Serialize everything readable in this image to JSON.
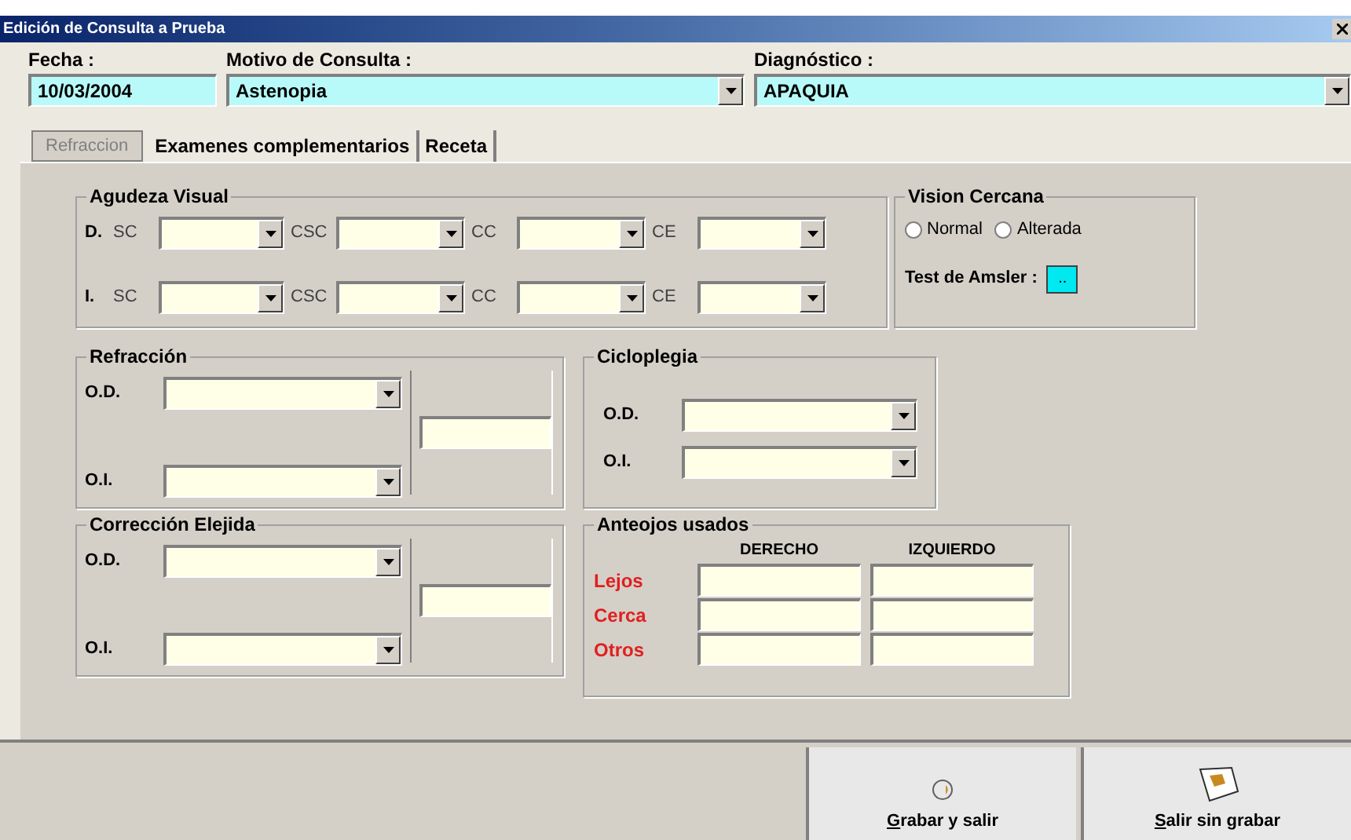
{
  "window": {
    "title": "Edición de Consulta a Prueba"
  },
  "header_fields": [
    {
      "label": "Fecha :",
      "value": "10/03/2004",
      "kind": "text"
    },
    {
      "label": "Motivo de Consulta :",
      "value": "Astenopia",
      "kind": "combo"
    },
    {
      "label": "Diagnóstico :",
      "value": "APAQUIA",
      "kind": "combo"
    }
  ],
  "tabs": [
    {
      "label": "Refraccion",
      "selected": true
    },
    {
      "label": "Examenes complementarios",
      "selected": false
    },
    {
      "label": "Receta",
      "selected": false
    }
  ],
  "agudeza_visual": {
    "title": "Agudeza Visual",
    "rows": [
      {
        "eye": "D.",
        "fields": [
          "SC",
          "CSC",
          "CC",
          "CE"
        ]
      },
      {
        "eye": "I.",
        "fields": [
          "SC",
          "CSC",
          "CC",
          "CE"
        ]
      }
    ]
  },
  "vision_cercana": {
    "title": "Vision Cercana",
    "options": [
      {
        "label": "Normal",
        "selected": false
      },
      {
        "label": "Alterada",
        "selected": false
      }
    ],
    "amsler_label": "Test de Amsler :",
    "amsler_button": ".."
  },
  "refraccion": {
    "title": "Refracción",
    "rows": [
      "O.D.",
      "O.I."
    ]
  },
  "cicloplegia": {
    "title": "Cicloplegia",
    "rows": [
      "O.D.",
      "O.I."
    ]
  },
  "correccion": {
    "title": "Corrección Elejida",
    "rows": [
      "O.D.",
      "O.I."
    ]
  },
  "anteojos": {
    "title": "Anteojos usados",
    "columns": [
      "DERECHO",
      "IZQUIERDO"
    ],
    "rows": [
      "Lejos",
      "Cerca",
      "Otros"
    ]
  },
  "buttons": [
    {
      "label": "Grabar y salir",
      "kind": "save"
    },
    {
      "label": "Salir sin grabar",
      "kind": "exit"
    }
  ]
}
